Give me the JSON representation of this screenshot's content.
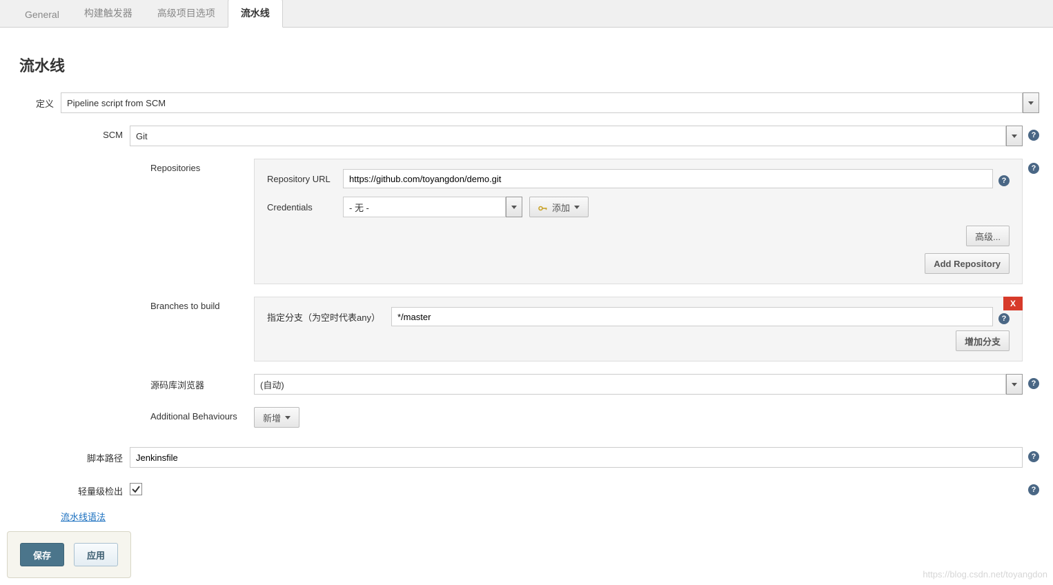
{
  "tabs": {
    "items": [
      {
        "label": "General"
      },
      {
        "label": "构建触发器"
      },
      {
        "label": "高级项目选项"
      },
      {
        "label": "流水线"
      }
    ],
    "activeIndex": 3
  },
  "section_title": "流水线",
  "definition": {
    "label": "定义",
    "value": "Pipeline script from SCM"
  },
  "scm": {
    "label": "SCM",
    "value": "Git"
  },
  "repositories": {
    "label": "Repositories",
    "url_label": "Repository URL",
    "url_value": "https://github.com/toyangdon/demo.git",
    "credentials_label": "Credentials",
    "credentials_value": "- 无 -",
    "add_cred_label": "添加",
    "advanced_label": "高级...",
    "add_repo_label": "Add Repository"
  },
  "branches": {
    "label": "Branches to build",
    "spec_label": "指定分支（为空时代表any）",
    "spec_value": "*/master",
    "add_branch_label": "增加分支",
    "delete_x": "X"
  },
  "repo_browser": {
    "label": "源码库浏览器",
    "value": "(自动)"
  },
  "additional_behaviours": {
    "label": "Additional Behaviours",
    "add_label": "新增"
  },
  "script_path": {
    "label": "脚本路径",
    "value": "Jenkinsfile"
  },
  "lightweight": {
    "label": "轻量级检出",
    "checked": true
  },
  "pipeline_syntax_link": "流水线语法",
  "footer": {
    "save": "保存",
    "apply": "应用"
  },
  "watermark": "https://blog.csdn.net/toyangdon",
  "help_tooltip": "?"
}
